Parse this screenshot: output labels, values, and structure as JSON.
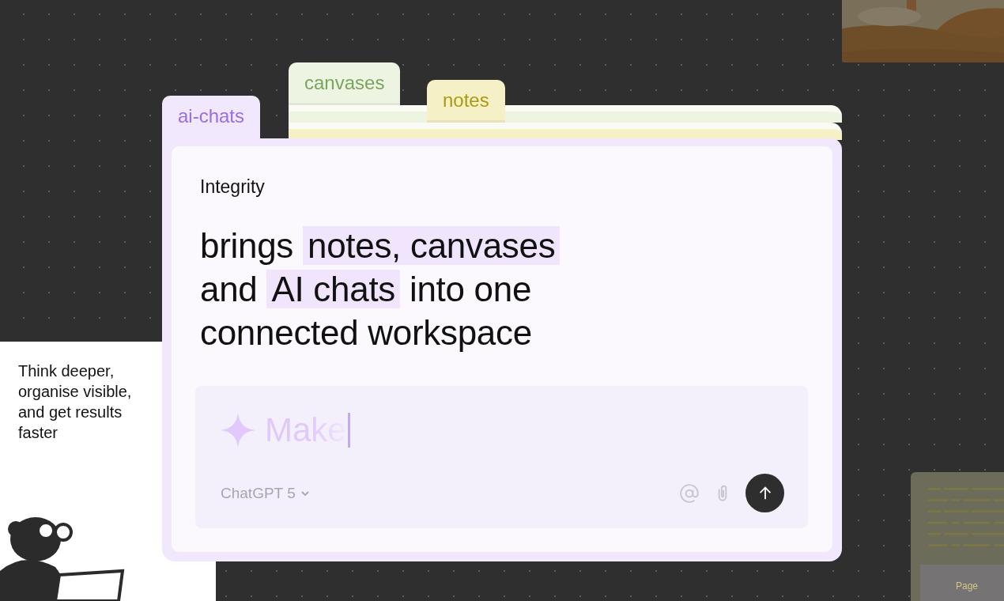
{
  "tabs": [
    {
      "label": "ai-chats",
      "kind": "chats",
      "selected": true
    },
    {
      "label": "canvases",
      "kind": "canvases",
      "selected": false
    },
    {
      "label": "notes",
      "kind": "notes",
      "selected": false
    }
  ],
  "card": {
    "title": "Integrity",
    "headline_lines": [
      "brings **notes, canvases**",
      "and **AI chats** into one",
      "connected workspace"
    ]
  },
  "composer": {
    "value": "Make",
    "model": "ChatGPT 5"
  },
  "side_card": {
    "text": "Think deeper, organise visible, and get results faster"
  },
  "page_card": {
    "label": "Page"
  }
}
